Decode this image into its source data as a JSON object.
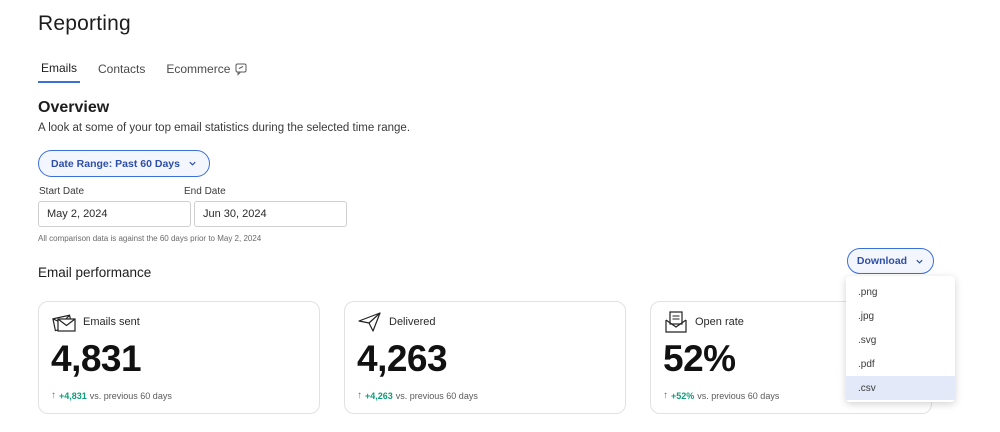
{
  "page": {
    "title": "Reporting"
  },
  "tabs": [
    {
      "label": "Emails",
      "active": true
    },
    {
      "label": "Contacts",
      "active": false
    },
    {
      "label": "Ecommerce",
      "active": false,
      "icon": "feedback-icon"
    }
  ],
  "overview": {
    "title": "Overview",
    "subtitle": "A look at some of your top email statistics during the selected time range.",
    "date_range_label": "Date Range: Past 60 Days",
    "start_label": "Start Date",
    "start_value": "May 2, 2024",
    "end_label": "End Date",
    "end_value": "Jun 30, 2024",
    "comparison_note": "All comparison data is against the 60 days prior to May 2, 2024"
  },
  "performance": {
    "title": "Email performance",
    "download_label": "Download",
    "download_options": [
      ".png",
      ".jpg",
      ".svg",
      ".pdf",
      ".csv"
    ],
    "selected_option": ".csv",
    "cards": [
      {
        "label": "Emails sent",
        "value": "4,831",
        "delta": "+4,831",
        "delta_suffix": "vs. previous 60 days",
        "icon": "envelopes-icon"
      },
      {
        "label": "Delivered",
        "value": "4,263",
        "delta": "+4,263",
        "delta_suffix": "vs. previous 60 days",
        "icon": "paper-plane-icon"
      },
      {
        "label": "Open rate",
        "value": "52%",
        "delta": "+52%",
        "delta_suffix": "vs. previous 60 days",
        "icon": "open-envelope-icon"
      }
    ]
  },
  "colors": {
    "accent": "#3b6fd9",
    "positive": "#0f9d77",
    "selected_bg": "#e3e9f8"
  }
}
